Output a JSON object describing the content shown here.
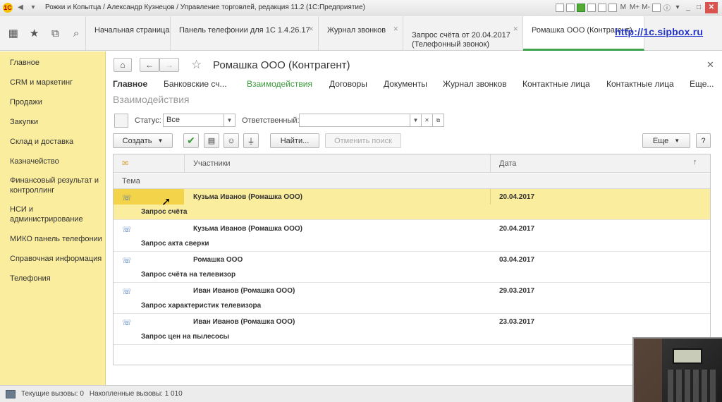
{
  "window": {
    "title": "Рожки и Копытца / Александр Кузнецов / Управление торговлей, редакция 11.2  (1С:Предприятие)",
    "controls": [
      "M",
      "M+",
      "M-"
    ]
  },
  "tabs": [
    {
      "label": "Начальная страница"
    },
    {
      "label": "Панель телефонии для 1С 1.4.26.17"
    },
    {
      "label": "Журнал звонков"
    },
    {
      "label": "Запрос счёта от 20.04.2017\n(Телефонный звонок)"
    },
    {
      "label": "Ромашка ООО (Контрагент)"
    }
  ],
  "overlay_url": "http://1c.sipbox.ru",
  "sidebar": {
    "items": [
      {
        "label": "Главное"
      },
      {
        "label": "CRM и маркетинг"
      },
      {
        "label": "Продажи"
      },
      {
        "label": "Закупки"
      },
      {
        "label": "Склад и доставка"
      },
      {
        "label": "Казначейство"
      },
      {
        "label": "Финансовый результат и контроллинг"
      },
      {
        "label": "НСИ и администрирование"
      },
      {
        "label": "МИКО панель телефонии"
      },
      {
        "label": "Справочная информация"
      },
      {
        "label": "Телефония"
      }
    ]
  },
  "form": {
    "title": "Ромашка ООО (Контрагент)",
    "nav": [
      "Главное",
      "Банковские сч...",
      "Взаимодействия",
      "Договоры",
      "Документы",
      "Журнал звонков",
      "Контактные лица",
      "Контактные лица",
      "Еще..."
    ],
    "section_title": "Взаимодействия",
    "status_label": "Статус:",
    "status_value": "Все",
    "responsible_label": "Ответственный:",
    "responsible_value": "",
    "buttons": {
      "create": "Создать",
      "find": "Найти...",
      "cancel_search": "Отменить поиск",
      "more": "Еще",
      "help": "?"
    }
  },
  "table": {
    "columns": {
      "participants": "Участники",
      "date": "Дата",
      "topic": "Тема"
    },
    "rows": [
      {
        "participants": "Кузьма Иванов (Ромашка ООО)",
        "date": "20.04.2017",
        "topic": "Запрос счёта",
        "selected": true
      },
      {
        "participants": "Кузьма Иванов (Ромашка ООО)",
        "date": "20.04.2017",
        "topic": "Запрос акта сверки",
        "selected": false
      },
      {
        "participants": "Ромашка ООО",
        "date": "03.04.2017",
        "topic": "Запрос счёта на телевизор",
        "selected": false
      },
      {
        "participants": "Иван Иванов (Ромашка ООО)",
        "date": "29.03.2017",
        "topic": "Запрос характеристик телевизора",
        "selected": false
      },
      {
        "participants": "Иван Иванов (Ромашка ООО)",
        "date": "23.03.2017",
        "topic": "Запрос цен на пылесосы",
        "selected": false
      }
    ]
  },
  "statusbar": {
    "current_calls": "Текущие вызовы: 0",
    "accumulated_calls": "Накопленные вызовы: 1 010"
  },
  "colors": {
    "sidebar_bg": "#fbed9e",
    "selected_row": "#fbed9e",
    "selected_cell": "#f3d34a",
    "active_tab_underline": "#3fa34d",
    "nav_active": "#3a9a3a"
  }
}
